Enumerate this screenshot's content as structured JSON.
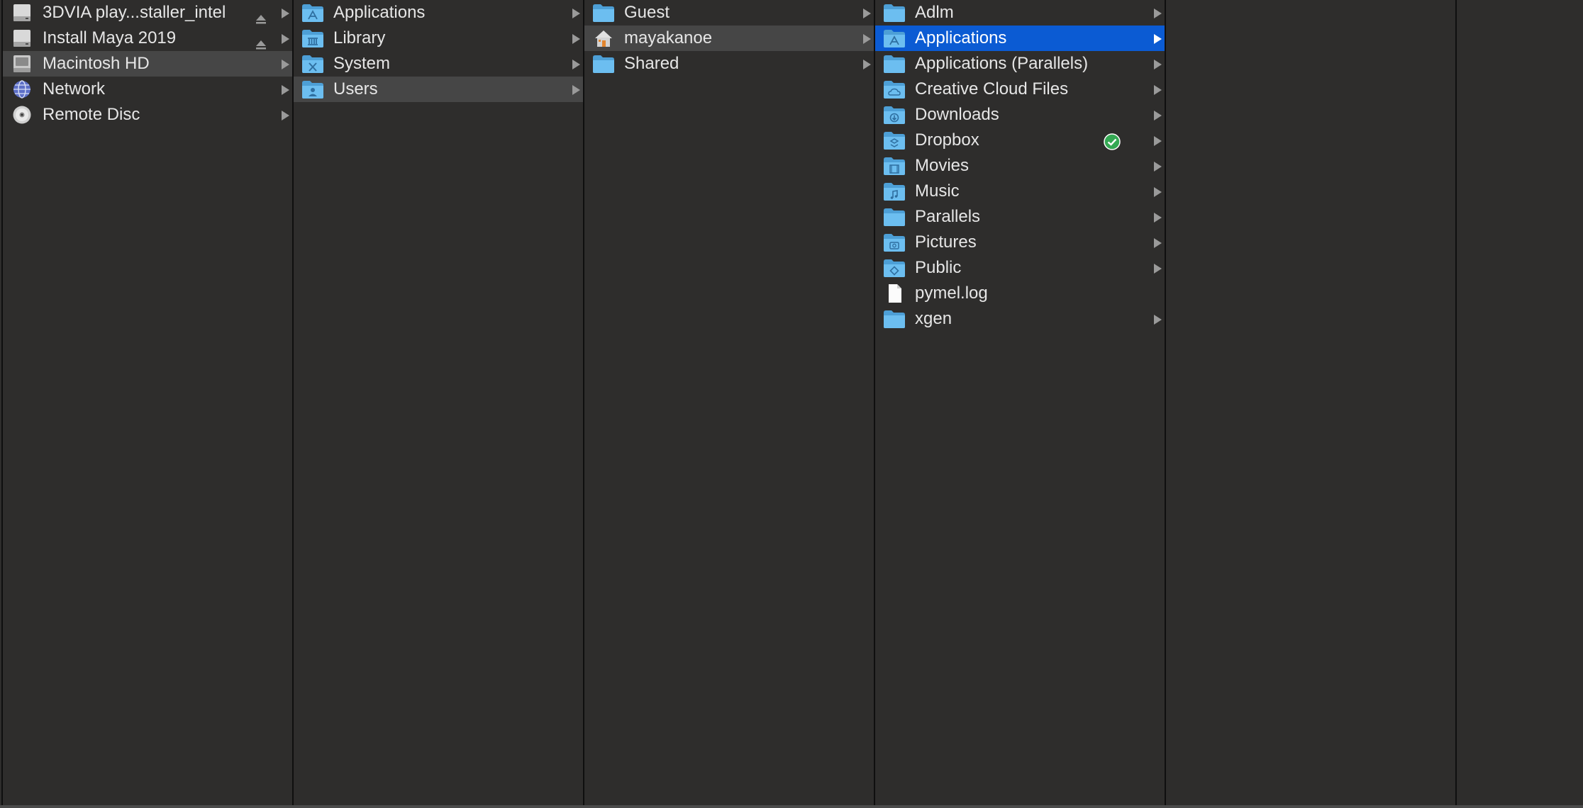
{
  "columns": [
    {
      "items": [
        {
          "label": "3DVIA play...staller_intel",
          "icon": "disk-image-icon",
          "eject": true,
          "chevron": true
        },
        {
          "label": "Install Maya 2019",
          "icon": "disk-image-icon",
          "eject": true,
          "chevron": true
        },
        {
          "label": "Macintosh HD",
          "icon": "hard-drive-icon",
          "chevron": true,
          "state": "path"
        },
        {
          "label": "Network",
          "icon": "network-globe-icon",
          "chevron": true
        },
        {
          "label": "Remote Disc",
          "icon": "optical-disc-icon",
          "chevron": true
        }
      ]
    },
    {
      "items": [
        {
          "label": "Applications",
          "icon": "applications-folder-icon",
          "chevron": true
        },
        {
          "label": "Library",
          "icon": "library-folder-icon",
          "chevron": true
        },
        {
          "label": "System",
          "icon": "system-folder-icon",
          "chevron": true
        },
        {
          "label": "Users",
          "icon": "users-folder-icon",
          "chevron": true,
          "state": "path"
        }
      ]
    },
    {
      "items": [
        {
          "label": "Guest",
          "icon": "folder-icon",
          "chevron": true
        },
        {
          "label": "mayakanoe",
          "icon": "home-icon",
          "chevron": true,
          "state": "path"
        },
        {
          "label": "Shared",
          "icon": "folder-icon",
          "chevron": true
        }
      ]
    },
    {
      "items": [
        {
          "label": "Adlm",
          "icon": "folder-icon",
          "chevron": true
        },
        {
          "label": "Applications",
          "icon": "applications-folder-icon",
          "chevron": true,
          "state": "selected"
        },
        {
          "label": "Applications (Parallels)",
          "icon": "folder-icon",
          "chevron": true
        },
        {
          "label": "Creative Cloud Files",
          "icon": "cloud-folder-icon",
          "chevron": true
        },
        {
          "label": "Downloads",
          "icon": "downloads-folder-icon",
          "chevron": true
        },
        {
          "label": "Dropbox",
          "icon": "dropbox-folder-icon",
          "chevron": true,
          "badge": "sync-check-icon"
        },
        {
          "label": "Movies",
          "icon": "movies-folder-icon",
          "chevron": true
        },
        {
          "label": "Music",
          "icon": "music-folder-icon",
          "chevron": true
        },
        {
          "label": "Parallels",
          "icon": "folder-icon",
          "chevron": true
        },
        {
          "label": "Pictures",
          "icon": "pictures-folder-icon",
          "chevron": true
        },
        {
          "label": "Public",
          "icon": "public-folder-icon",
          "chevron": true
        },
        {
          "label": "pymel.log",
          "icon": "document-icon",
          "chevron": false
        },
        {
          "label": "xgen",
          "icon": "folder-icon",
          "chevron": true
        }
      ]
    },
    {
      "items": []
    },
    {
      "items": []
    }
  ],
  "colors": {
    "background": "#2e2d2c",
    "path_highlight": "#464646",
    "selection": "#0b5bd3",
    "folder": "#5fb3e8",
    "sync_check": "#34a853"
  }
}
